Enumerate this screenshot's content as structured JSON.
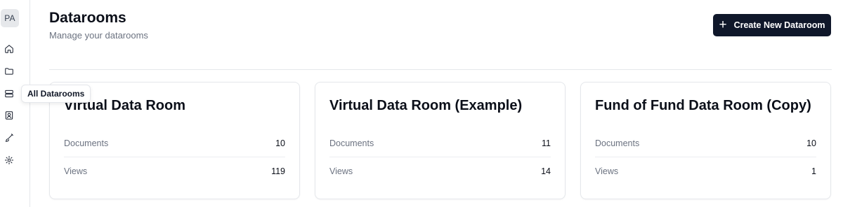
{
  "sidebar": {
    "avatar_initials": "PA",
    "items": [
      {
        "icon": "home-icon"
      },
      {
        "icon": "folder-icon"
      },
      {
        "icon": "datarooms-icon",
        "tooltip": "All Datarooms"
      },
      {
        "icon": "contact-icon"
      },
      {
        "icon": "brush-icon"
      },
      {
        "icon": "gear-icon"
      }
    ]
  },
  "header": {
    "title": "Datarooms",
    "subtitle": "Manage your datarooms",
    "create_label": "Create New Dataroom"
  },
  "datarooms": [
    {
      "name": "Virtual Data Room",
      "documents_label": "Documents",
      "documents": "10",
      "views_label": "Views",
      "views": "119"
    },
    {
      "name": "Virtual Data Room (Example)",
      "documents_label": "Documents",
      "documents": "11",
      "views_label": "Views",
      "views": "14"
    },
    {
      "name": "Fund of Fund Data Room (Copy)",
      "documents_label": "Documents",
      "documents": "10",
      "views_label": "Views",
      "views": "1"
    }
  ],
  "colors": {
    "primary_button": "#0f172a",
    "muted_text": "#6b7280",
    "border": "#e5e7eb"
  }
}
